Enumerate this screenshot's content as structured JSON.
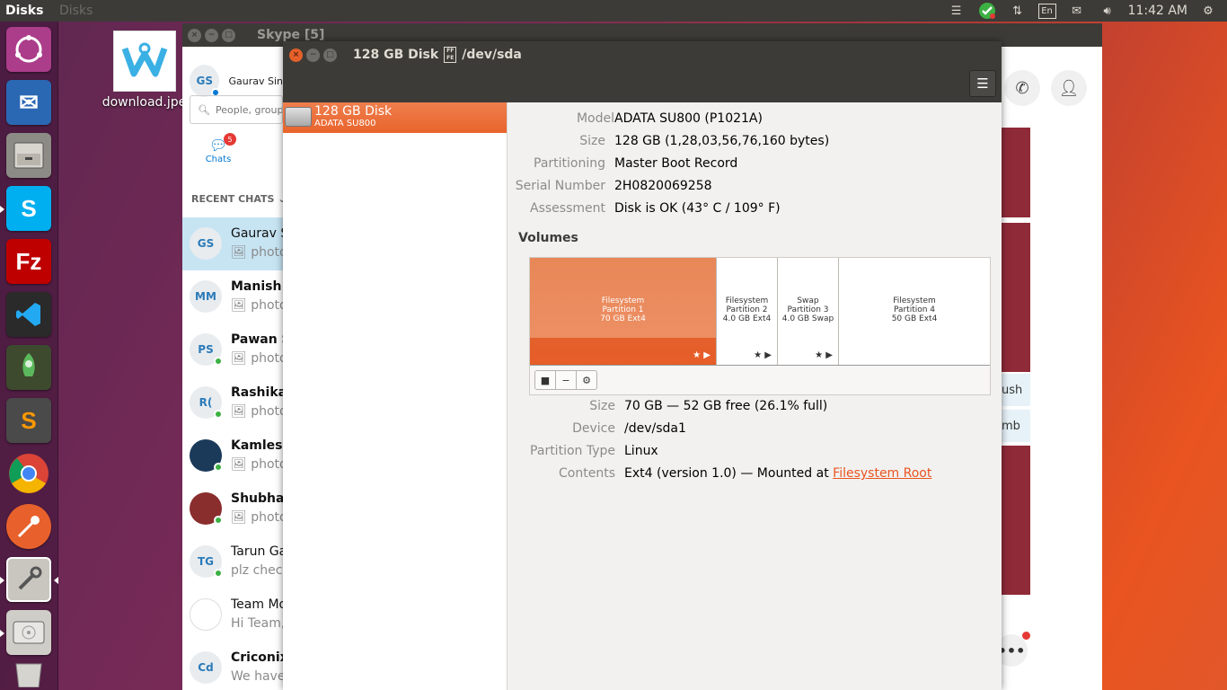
{
  "top_panel": {
    "app_title": "Disks",
    "inactive_title": "Disks",
    "lang": "En",
    "clock": "11:42 AM"
  },
  "desktop": {
    "icon_label": "download.jpe"
  },
  "skype": {
    "title": "Skype [5]",
    "profile_initials": "GS",
    "profile_name": "Gaurav Sin",
    "search_placeholder": "People, group",
    "chats_label": "Chats",
    "chats_badge": "5",
    "recent_label": "RECENT CHATS",
    "chats": [
      {
        "initials": "GS",
        "name": "Gaurav S",
        "msg": "photo",
        "active": true
      },
      {
        "initials": "MM",
        "name": "Manish",
        "msg": "photo"
      },
      {
        "initials": "PS",
        "name": "Pawan S",
        "msg": "photo"
      },
      {
        "initials": "R(",
        "name": "Rashika",
        "msg": "photo"
      },
      {
        "initials": "",
        "name": "Kamlesh",
        "msg": "photo"
      },
      {
        "initials": "",
        "name": "Shubhar",
        "msg": "photo"
      },
      {
        "initials": "TG",
        "name": "Tarun Ga",
        "msg": "plz check"
      },
      {
        "initials": "",
        "name": "Team Mo",
        "msg": "Hi Team,"
      },
      {
        "initials": "Cd",
        "name": "Criconix",
        "msg": "We have"
      }
    ],
    "side_text_1": "ush",
    "side_text_2": "mb"
  },
  "disks": {
    "window_title": "128 GB Disk",
    "device_path": "/dev/sda",
    "drive": {
      "name": "128 GB Disk",
      "model": "ADATA SU800"
    },
    "props": [
      {
        "k": "Model",
        "v": "ADATA SU800 (P1021A)"
      },
      {
        "k": "Size",
        "v": "128 GB (1,28,03,56,76,160 bytes)"
      },
      {
        "k": "Partitioning",
        "v": "Master Boot Record"
      },
      {
        "k": "Serial Number",
        "v": "2H0820069258"
      },
      {
        "k": "Assessment",
        "v": "Disk is OK (43° C / 109° F)"
      }
    ],
    "volumes_title": "Volumes",
    "partitions": [
      {
        "l1": "Filesystem",
        "l2": "Partition 1",
        "l3": "70 GB Ext4",
        "marks": "★ ▶"
      },
      {
        "l1": "Filesystem",
        "l2": "Partition 2",
        "l3": "4.0 GB Ext4",
        "marks": "★ ▶"
      },
      {
        "l1": "Swap",
        "l2": "Partition 3",
        "l3": "4.0 GB Swap",
        "marks": "★ ▶"
      },
      {
        "l1": "Filesystem",
        "l2": "Partition 4",
        "l3": "50 GB Ext4",
        "marks": ""
      }
    ],
    "vol_props": [
      {
        "k": "Size",
        "v": "70 GB — 52 GB free (26.1% full)"
      },
      {
        "k": "Device",
        "v": "/dev/sda1"
      },
      {
        "k": "Partition Type",
        "v": "Linux"
      },
      {
        "k": "Contents",
        "v": "Ext4 (version 1.0) — Mounted at "
      }
    ],
    "mount_link": "Filesystem Root"
  },
  "colors": {
    "accent": "#e95420",
    "panel": "#3c3b37"
  }
}
